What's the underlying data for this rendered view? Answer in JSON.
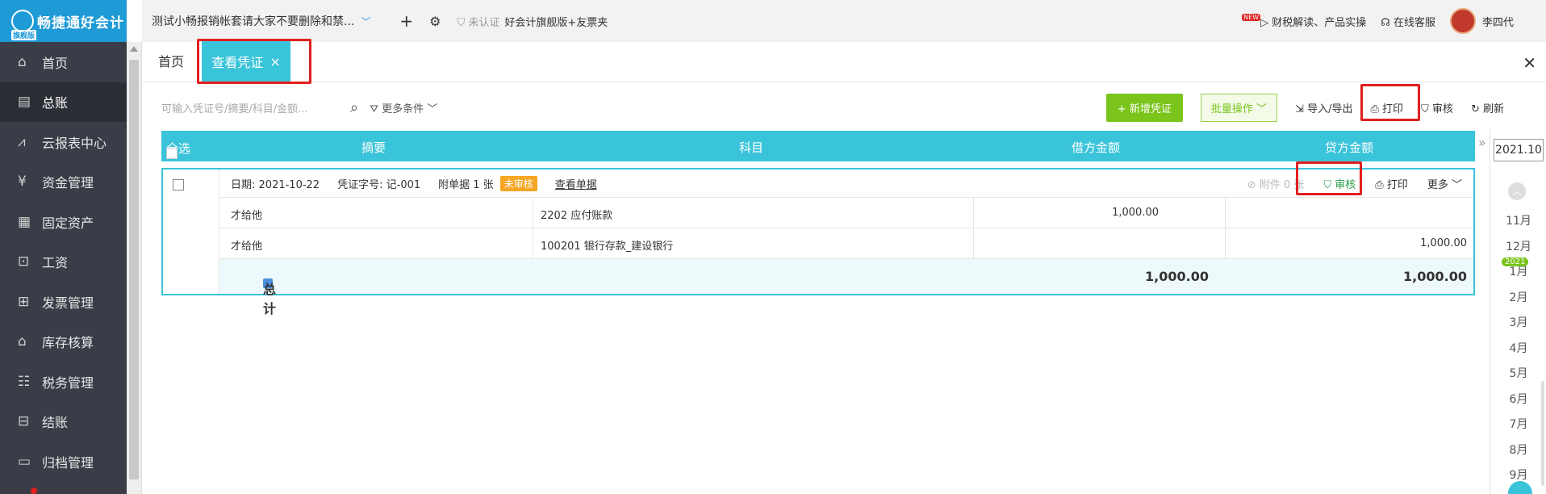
{
  "app": {
    "logo_text": "畅捷通好会计",
    "edition_badge": "旗舰版"
  },
  "sidebar": {
    "items": [
      {
        "label": "首页",
        "icon": "⌂"
      },
      {
        "label": "总账",
        "icon": "▤"
      },
      {
        "label": "云报表中心",
        "icon": "⩘"
      },
      {
        "label": "资金管理",
        "icon": "¥"
      },
      {
        "label": "固定资产",
        "icon": "▦"
      },
      {
        "label": "工资",
        "icon": "⊡"
      },
      {
        "label": "发票管理",
        "icon": "⊞"
      },
      {
        "label": "库存核算",
        "icon": "⌂"
      },
      {
        "label": "税务管理",
        "icon": "☷"
      },
      {
        "label": "结账",
        "icon": "⊟"
      },
      {
        "label": "归档管理",
        "icon": "▭"
      }
    ],
    "active_index": 1
  },
  "topbar": {
    "company": "测试小畅报销帐套请大家不要删除和禁...",
    "cert": "未认证",
    "edition": "好会计旗舰版+友票夹",
    "new_badge": "NEW",
    "news": "财税解读、产品实操",
    "service": "在线客服",
    "user": "李四代"
  },
  "tabs": {
    "home": "首页",
    "active": "查看凭证",
    "close": "×"
  },
  "toolbar": {
    "search_placeholder": "可输入凭证号/摘要/科目/金额...",
    "more_conditions": "更多条件",
    "new_voucher": "新增凭证",
    "batch": "批量操作",
    "import_export": "导入/导出",
    "print": "打印",
    "audit": "审核",
    "refresh": "刷新"
  },
  "table": {
    "headers": {
      "select_all": "全选",
      "summary": "摘要",
      "account": "科目",
      "debit": "借方金额",
      "credit": "贷方金额"
    }
  },
  "voucher": {
    "date_label": "日期:",
    "date": "2021-10-22",
    "number_label": "凭证字号:",
    "number": "记-001",
    "attachments": "附单据 1 张",
    "status": "未审核",
    "view_docs": "查看单据",
    "attach_count": "附件 0 张",
    "audit": "审核",
    "print": "打印",
    "more": "更多",
    "rows": [
      {
        "summary": "才给他",
        "account": "2202 应付账款",
        "debit": "1,000.00",
        "credit": ""
      },
      {
        "summary": "才给他",
        "account": "100201 银行存款_建设银行",
        "debit": "",
        "credit": "1,000.00"
      }
    ],
    "total_label": "总计",
    "total_debit": "1,000.00",
    "total_credit": "1,000.00"
  },
  "month_panel": {
    "current": "2021.10",
    "year_badge": "2021",
    "months": [
      "11月",
      "12月",
      "1月",
      "2月",
      "3月",
      "4月",
      "5月",
      "6月",
      "7月",
      "8月",
      "9月"
    ]
  },
  "colors": {
    "accent": "#3ac4d9",
    "sidebar": "#3a3d47",
    "green": "#7ac41c",
    "highlight": "#e02020"
  }
}
